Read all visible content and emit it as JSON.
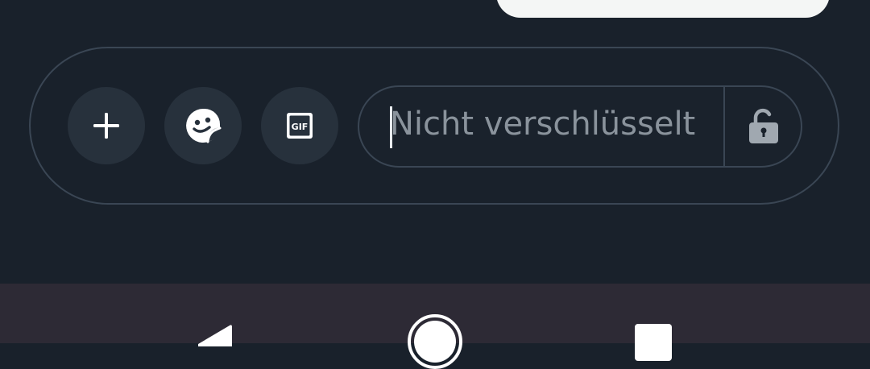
{
  "composer": {
    "attach_icon": "plus-icon",
    "sticker_icon": "sticker-icon",
    "gif_icon": "gif-icon",
    "gif_label": "GIF",
    "input_value": "Nicht verschlüsselt",
    "lock_icon": "unlocked-padlock-icon"
  },
  "navigation": {
    "back_icon": "back-triangle-icon",
    "home_icon": "home-circle-icon",
    "recents_icon": "recents-square-icon"
  },
  "colors": {
    "background": "#19212b",
    "button_fill": "#27313c",
    "outline": "#3a4654",
    "placeholder_text": "#8a939c",
    "nav_bar": "#2d2a35",
    "bubble": "#f4f6f5"
  }
}
